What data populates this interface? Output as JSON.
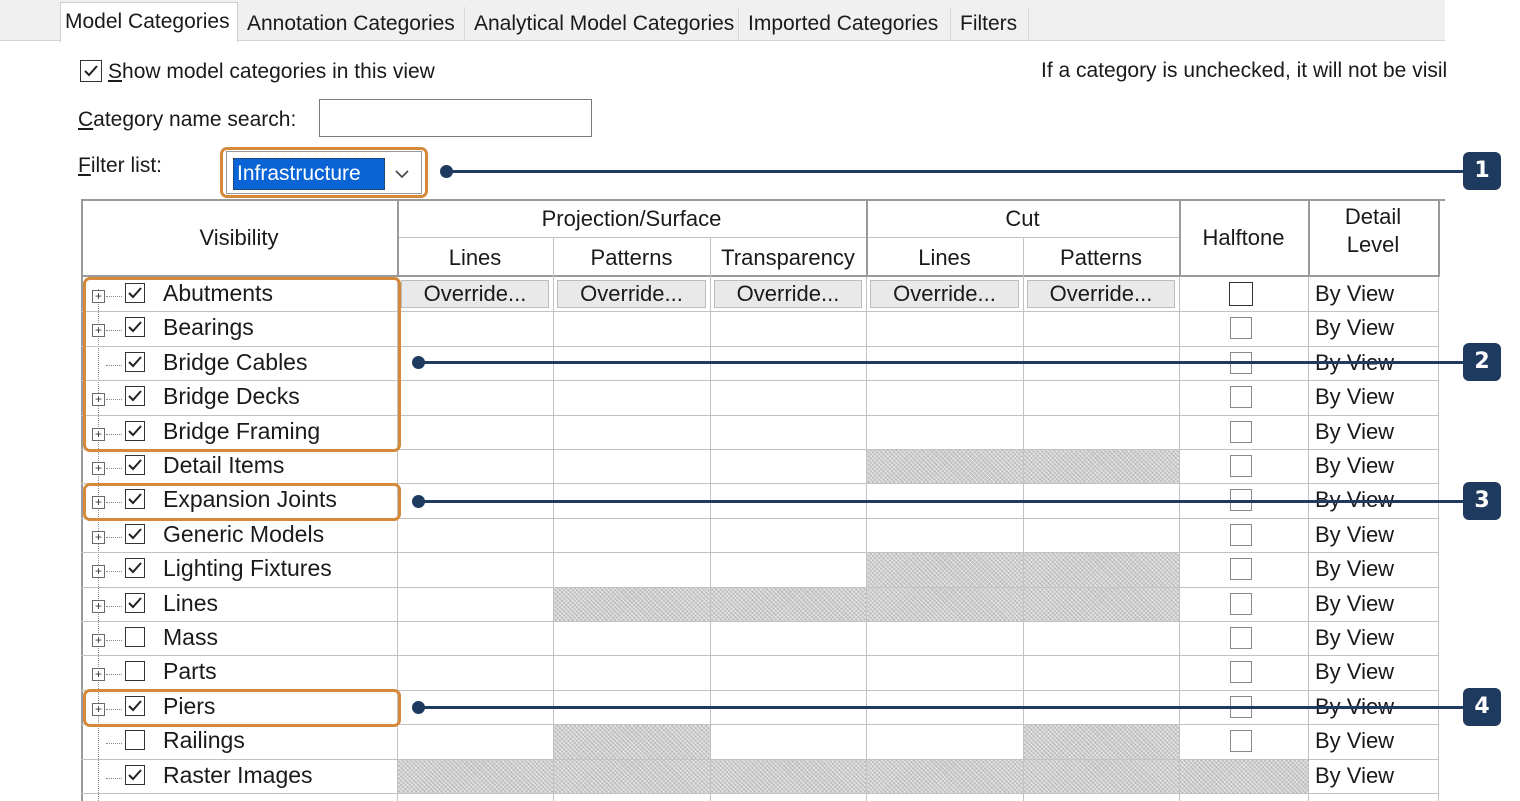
{
  "tabs": [
    {
      "label": "Model Categories",
      "active": true
    },
    {
      "label": "Annotation Categories"
    },
    {
      "label": "Analytical Model Categories"
    },
    {
      "label": "Imported Categories"
    },
    {
      "label": "Filters"
    }
  ],
  "show_model": {
    "prefix": "S",
    "rest": "how model categories in this view",
    "checked": true
  },
  "info_text": "If a category is unchecked, it will not be visil",
  "search": {
    "prefix": "C",
    "rest": "ategory name search:",
    "value": ""
  },
  "filter": {
    "prefix": "F",
    "rest": "ilter list:",
    "value": "Infrastructure"
  },
  "columns": {
    "visibility": "Visibility",
    "projection": "Projection/Surface",
    "cut": "Cut",
    "lines": "Lines",
    "patterns": "Patterns",
    "transparency": "Transparency",
    "halftone": "Halftone",
    "detail_level_1": "Detail",
    "detail_level_2": "Level"
  },
  "override_label": "Override...",
  "rows": [
    {
      "name": "Abutments",
      "checked": true,
      "expandable": true,
      "detail": "By View",
      "hatch": []
    },
    {
      "name": "Bearings",
      "checked": true,
      "expandable": true,
      "detail": "By View",
      "hatch": []
    },
    {
      "name": "Bridge Cables",
      "checked": true,
      "expandable": false,
      "detail": "By View",
      "hatch": []
    },
    {
      "name": "Bridge Decks",
      "checked": true,
      "expandable": true,
      "detail": "By View",
      "hatch": []
    },
    {
      "name": "Bridge Framing",
      "checked": true,
      "expandable": true,
      "detail": "By View",
      "hatch": []
    },
    {
      "name": "Detail Items",
      "checked": true,
      "expandable": true,
      "detail": "By View",
      "hatch": [
        "cutLines",
        "cutPatterns"
      ]
    },
    {
      "name": "Expansion Joints",
      "checked": true,
      "expandable": true,
      "detail": "By View",
      "hatch": []
    },
    {
      "name": "Generic Models",
      "checked": true,
      "expandable": true,
      "detail": "By View",
      "hatch": []
    },
    {
      "name": "Lighting Fixtures",
      "checked": true,
      "expandable": true,
      "detail": "By View",
      "hatch": [
        "cutLines",
        "cutPatterns"
      ]
    },
    {
      "name": "Lines",
      "checked": true,
      "expandable": true,
      "detail": "By View",
      "hatch": [
        "projPatterns",
        "transparency",
        "cutLines",
        "cutPatterns"
      ]
    },
    {
      "name": "Mass",
      "checked": false,
      "expandable": true,
      "detail": "By View",
      "hatch": []
    },
    {
      "name": "Parts",
      "checked": false,
      "expandable": true,
      "detail": "By View",
      "hatch": []
    },
    {
      "name": "Piers",
      "checked": true,
      "expandable": true,
      "detail": "By View",
      "hatch": []
    },
    {
      "name": "Railings",
      "checked": false,
      "expandable": false,
      "detail": "By View",
      "hatch": [
        "projPatterns",
        "cutPatterns"
      ]
    },
    {
      "name": "Raster Images",
      "checked": true,
      "expandable": false,
      "detail": "By View",
      "hatch": [
        "projLines",
        "projPatterns",
        "transparency",
        "cutLines",
        "cutPatterns",
        "halftone"
      ]
    }
  ],
  "callouts": [
    "1",
    "2",
    "3",
    "4"
  ],
  "colors": {
    "highlight": "#d48a3a",
    "callout": "#1f3a5f",
    "selection": "#0a64d6"
  }
}
